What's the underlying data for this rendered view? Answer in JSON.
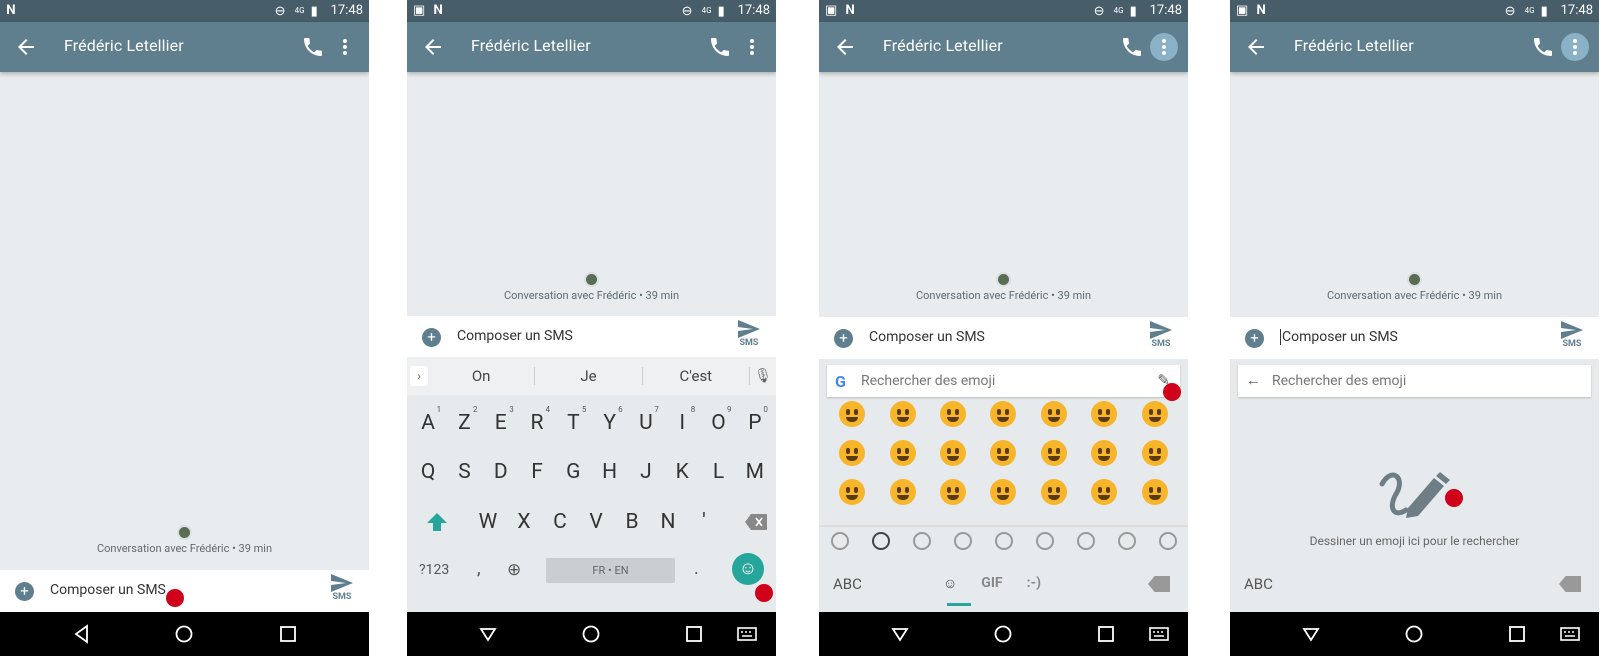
{
  "status": {
    "time": "17:48",
    "network": "4G"
  },
  "appbar": {
    "contact_name": "Frédéric Letellier"
  },
  "conversation": {
    "label": "Conversation avec Frédéric • 39 min"
  },
  "composer": {
    "placeholder": "Composer un SMS",
    "send_label": "SMS"
  },
  "keyboard": {
    "suggestions": [
      "On",
      "Je",
      "C'est"
    ],
    "row1": [
      {
        "k": "A",
        "n": "1"
      },
      {
        "k": "Z",
        "n": "2"
      },
      {
        "k": "E",
        "n": "3"
      },
      {
        "k": "R",
        "n": "4"
      },
      {
        "k": "T",
        "n": "5"
      },
      {
        "k": "Y",
        "n": "6"
      },
      {
        "k": "U",
        "n": "7"
      },
      {
        "k": "I",
        "n": "8"
      },
      {
        "k": "O",
        "n": "9"
      },
      {
        "k": "P",
        "n": "0"
      }
    ],
    "row2": [
      "Q",
      "S",
      "D",
      "F",
      "G",
      "H",
      "J",
      "K",
      "L",
      "M"
    ],
    "row3": [
      "W",
      "X",
      "C",
      "V",
      "B",
      "N",
      "'"
    ],
    "sym_label": "?123",
    "comma": ",",
    "space_label": "FR • EN",
    "period": "."
  },
  "emoji": {
    "search_placeholder": "Rechercher des emoji",
    "draw_hint": "Dessiner un emoji ici pour le rechercher",
    "abc_label": "ABC",
    "gif_label": "GIF",
    "emoticon_label": ":-)",
    "google_letter": "G"
  },
  "colors": {
    "appbar": "#5f7f8f",
    "statusbar": "#475d69",
    "accent": "#26a69a",
    "marker": "#d0021b"
  }
}
